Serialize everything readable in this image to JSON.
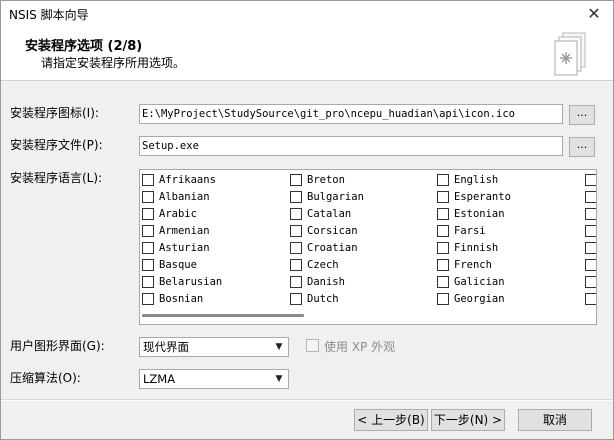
{
  "window": {
    "title": "NSIS 脚本向导",
    "close_glyph": "✕"
  },
  "header": {
    "title": "安装程序选项 (2/8)",
    "subtitle": "请指定安装程序所用选项。",
    "icon": "wizard-document-icon"
  },
  "fields": {
    "icon_label": "安装程序图标(I):",
    "icon_value": "E:\\MyProject\\StudySource\\git_pro\\ncepu_huadian\\api\\icon.ico",
    "file_label": "安装程序文件(P):",
    "file_value": "Setup.exe",
    "browse_label": "...",
    "lang_label": "安装程序语言(L):"
  },
  "languages": [
    [
      "Afrikaans",
      "Albanian",
      "Arabic",
      "Armenian",
      "Asturian",
      "Basque",
      "Belarusian",
      "Bosnian"
    ],
    [
      "Breton",
      "Bulgarian",
      "Catalan",
      "Corsican",
      "Croatian",
      "Czech",
      "Danish",
      "Dutch"
    ],
    [
      "English",
      "Esperanto",
      "Estonian",
      "Farsi",
      "Finnish",
      "French",
      "Galician",
      "Georgian"
    ]
  ],
  "ui": {
    "gui_label": "用户图形界面(G):",
    "gui_value": "现代界面",
    "xp_label": "使用 XP 外观",
    "compress_label": "压缩算法(O):",
    "compress_value": "LZMA"
  },
  "buttons": {
    "back": "< 上一步(B)",
    "next": "下一步(N) >",
    "cancel": "取消"
  }
}
